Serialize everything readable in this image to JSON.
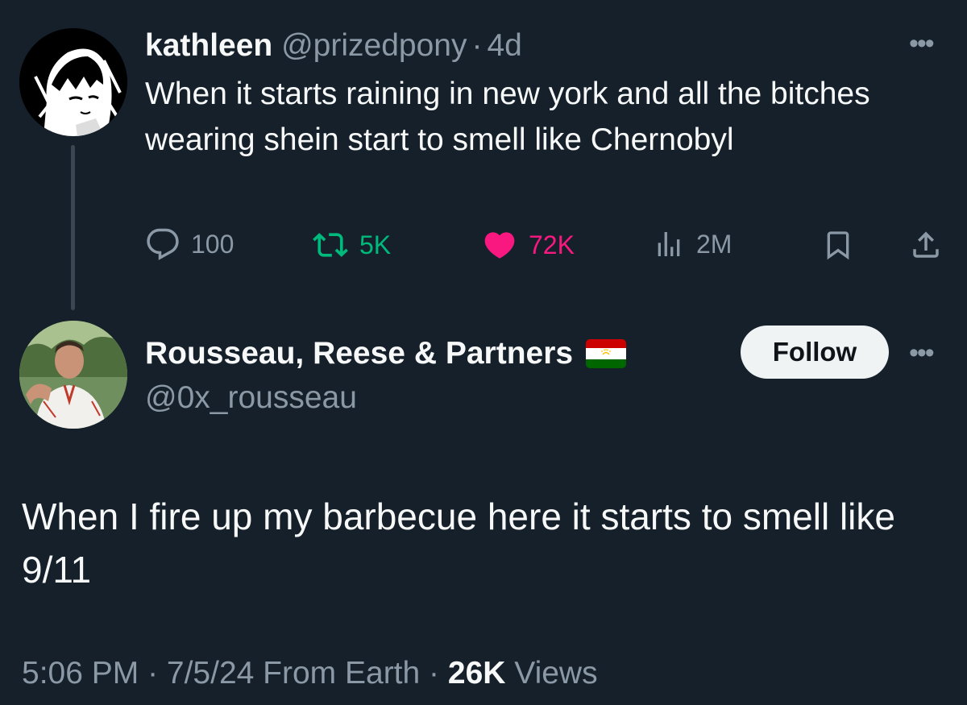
{
  "parent_tweet": {
    "display_name": "kathleen",
    "handle": "@prizedpony",
    "separator": "·",
    "time": "4d",
    "text": "When it starts raining in new york and all the bitches wearing shein start to smell like Chernobyl",
    "stats": {
      "replies": "100",
      "retweets": "5K",
      "likes": "72K",
      "views": "2M"
    },
    "more_label": "•••"
  },
  "reply_tweet": {
    "display_name": "Rousseau, Reese & Partners",
    "flag_icon": "tajikistan-flag-icon",
    "handle": "@0x_rousseau",
    "follow_label": "Follow",
    "more_label": "•••",
    "text": "When I fire up my barbecue here it starts to smell like 9/11",
    "meta": {
      "timestamp": "5:06 PM · 7/5/24 From Earth ·",
      "views_count": "26K",
      "views_label": "Views"
    }
  },
  "colors": {
    "background": "#15202b",
    "text_primary": "#f7f9f9",
    "text_secondary": "#8b98a5",
    "retweet_green": "#00ba7c",
    "like_pink": "#f91880",
    "button_bg": "#eff3f4"
  }
}
